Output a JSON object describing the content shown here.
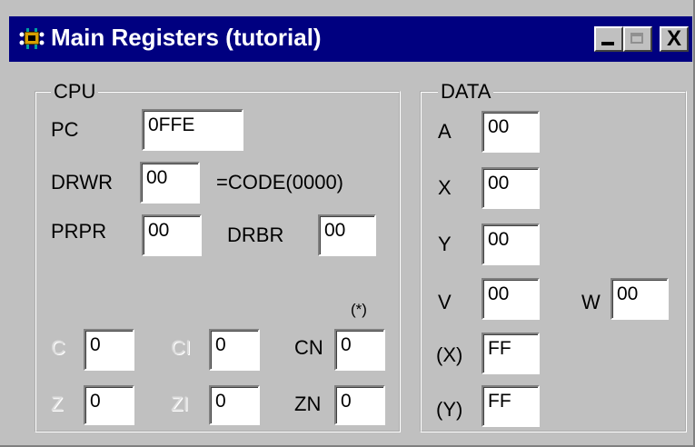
{
  "window": {
    "title": "Main Registers (tutorial)",
    "icon": "cpu-app-icon",
    "controls": [
      "minimize",
      "maximize",
      "close"
    ],
    "close_glyph": "X"
  },
  "cpu": {
    "group_label": "CPU",
    "pc": {
      "label": "PC",
      "value": "0FFE"
    },
    "drwr": {
      "label": "DRWR",
      "value": "00",
      "annotation": "=CODE(0000)"
    },
    "prpr": {
      "label": "PRPR",
      "value": "00"
    },
    "drbr": {
      "label": "DRBR",
      "value": "00"
    },
    "star_note": "(*)",
    "flags": {
      "c": {
        "label": "C",
        "value": "0"
      },
      "ci": {
        "label": "CI",
        "value": "0"
      },
      "cn": {
        "label": "CN",
        "value": "0"
      },
      "z": {
        "label": "Z",
        "value": "0"
      },
      "zi": {
        "label": "ZI",
        "value": "0"
      },
      "zn": {
        "label": "ZN",
        "value": "0"
      }
    }
  },
  "data": {
    "group_label": "DATA",
    "a": {
      "label": "A",
      "value": "00"
    },
    "x": {
      "label": "X",
      "value": "00"
    },
    "y": {
      "label": "Y",
      "value": "00"
    },
    "v": {
      "label": "V",
      "value": "00"
    },
    "w": {
      "label": "W",
      "value": "00"
    },
    "ix": {
      "label": "(X)",
      "value": "FF"
    },
    "iy": {
      "label": "(Y)",
      "value": "FF"
    }
  },
  "colors": {
    "titlebar": "#000080",
    "window_bg": "#c0c0c0",
    "disabled_text": "#dcdcdc"
  }
}
